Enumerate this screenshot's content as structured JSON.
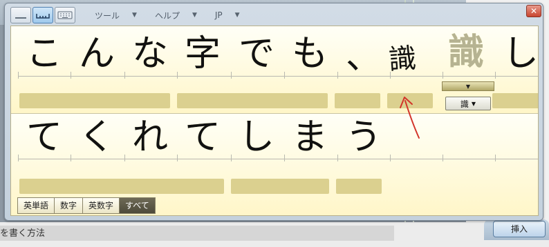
{
  "toolbar": {
    "menus": [
      {
        "label": "ツール",
        "caret": "▼"
      },
      {
        "label": "ヘルプ",
        "caret": "▼"
      },
      {
        "label": "JP",
        "caret": "▼"
      }
    ],
    "close_label": "✕"
  },
  "pad": {
    "row1_chars": [
      "こ",
      "ん",
      "な",
      "字",
      "で",
      "も",
      "、"
    ],
    "row1_handwritten": "識",
    "row1_recognized": "識",
    "row1_last": "し",
    "row2_chars": [
      "て",
      "く",
      "れ",
      "て",
      "し",
      "ま",
      "う"
    ],
    "candidate": {
      "label": "識",
      "caret": "▼"
    },
    "dropdown_caret": "▼"
  },
  "mode_tabs": [
    {
      "label": "英単語",
      "active": false
    },
    {
      "label": "数字",
      "active": false
    },
    {
      "label": "英数字",
      "active": false
    },
    {
      "label": "すべて",
      "active": true
    }
  ],
  "insert_label": "挿入",
  "background_text": "を書く方法",
  "colors": {
    "pad_bg": "#fffce0",
    "bar": "#dbd08f",
    "annotation_arrow": "#d2342a"
  }
}
